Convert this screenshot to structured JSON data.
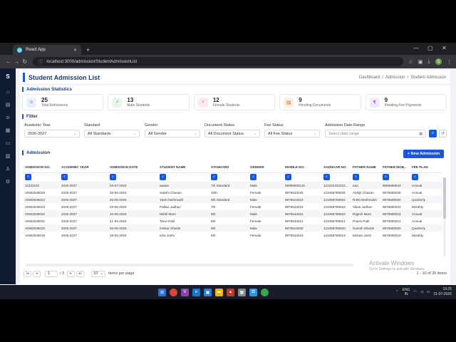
{
  "browser": {
    "tab_title": "React App",
    "url": "localhost:3000/admission/StudentAdmissionList",
    "profile_initial": "S"
  },
  "sidebar": {
    "logo": "S"
  },
  "header": {
    "title": "Student Admission List",
    "breadcrumb": [
      "Dashboard",
      "/",
      "Admission",
      "/",
      "Student Admission"
    ]
  },
  "stats_title": "Admission Statistics",
  "stats": [
    {
      "value": "25",
      "label": "Total Admissions",
      "icon": "users-icon",
      "color": "#1a56db",
      "bg": "#e8f0fe",
      "glyph": "&#9786;"
    },
    {
      "value": "13",
      "label": "Male Students",
      "icon": "male-icon",
      "color": "#16a34a",
      "bg": "#e6f7ec",
      "glyph": "&#9794;"
    },
    {
      "value": "12",
      "label": "Female Students",
      "icon": "female-icon",
      "color": "#db2777",
      "bg": "#fde8f1",
      "glyph": "&#9792;"
    },
    {
      "value": "9",
      "label": "Pending Documents",
      "icon": "document-icon",
      "color": "#ea580c",
      "bg": "#fdefe3",
      "glyph": "&#9636;"
    },
    {
      "value": "9",
      "label": "Pending Fee Payments",
      "icon": "rupee-icon",
      "color": "#9333ea",
      "bg": "#f3e8fd",
      "glyph": "&#8377;"
    }
  ],
  "filter": {
    "title": "Filter",
    "academic_year": {
      "label": "Academic Year",
      "value": "2026-2027"
    },
    "standard": {
      "label": "Standard",
      "value": "All Standards"
    },
    "gender": {
      "label": "Gender",
      "value": "All Gender"
    },
    "document_status": {
      "label": "Document Status",
      "value": "All Document Status"
    },
    "fee_status": {
      "label": "Fee Status",
      "value": "All Fee Status"
    },
    "date_range": {
      "label": "Admission Date Range",
      "placeholder": "Select date range"
    }
  },
  "admission": {
    "title": "Admission",
    "new_button": "+ New Admission"
  },
  "table": {
    "columns": [
      "ADMISSION NO.",
      "ACADEMIC YEAR",
      "ADMISSION DATE",
      "STUDENT NAME",
      "STANDARD",
      "GENDER",
      "MOBILE NO.",
      "AADHAAR NO.",
      "FATHER NAME",
      "FATHER MOB...",
      "FEE PLAN"
    ],
    "rows": [
      [
        "11222222",
        "2026-2027",
        "04-07-2026",
        "aaaaa",
        "7th Standard",
        "Male",
        "09099063131",
        "122222222222...",
        "aaa",
        "9066666644",
        "Annual"
      ],
      [
        "ADM2026025",
        "2026-2027",
        "25-06-2026",
        "Sakshi Chavan",
        "10th",
        "Female",
        "9876543225",
        "123456789025",
        "Abhijit Chavan",
        "9876500025",
        "Annual"
      ],
      [
        "ADM2026024",
        "2026-2027",
        "26-06-2026",
        "Yash Deshmukh",
        "5th Standard",
        "Male",
        "9876543224",
        "123456789024",
        "Rohit Deshmukh",
        "9876500024",
        "Quarterly"
      ],
      [
        "ADM2026023",
        "2026-2027",
        "23-06-2026",
        "Pallavi Jadhav",
        "7th",
        "Female",
        "9876543223",
        "123456789023",
        "Vikas Jadhav",
        "9876500023",
        "Monthly"
      ],
      [
        "ADM2026022",
        "2026-2027",
        "22-06-2026",
        "Nikhil More",
        "8th",
        "Male",
        "9876543222",
        "123456789022",
        "Rajesh More",
        "9876500022",
        "Annual"
      ],
      [
        "ADM2026021",
        "2026-2027",
        "21-06-2026",
        "Tanvi Patil",
        "8th",
        "Female",
        "9876543221",
        "123456789021",
        "Pravin Patil",
        "9876500021",
        "Annual"
      ],
      [
        "ADM2026020",
        "2026-2027",
        "20-06-2026",
        "Omkar Shinde",
        "6th",
        "Male",
        "9876543220",
        "123456789020",
        "Suresh Shinde",
        "9876500020",
        "Quarterly"
      ],
      [
        "ADM2026019",
        "2026-2027",
        "19-06-2026",
        "Isha Joshi",
        "5th",
        "Female",
        "9876543219",
        "123456789019",
        "Mohan Joshi",
        "9876500019",
        "Monthly"
      ]
    ]
  },
  "pager": {
    "page": "1",
    "of_pages": "/ 3",
    "page_size": "10",
    "items_per_page": "items per page",
    "range": "1 - 10 of 25 items"
  },
  "watermark": {
    "line1": "Activate Windows",
    "line2": "Go to Settings to activate Windows."
  },
  "taskbar": {
    "lang": "ENG",
    "region": "IN",
    "time": "19:25",
    "date": "31-07-2026"
  }
}
